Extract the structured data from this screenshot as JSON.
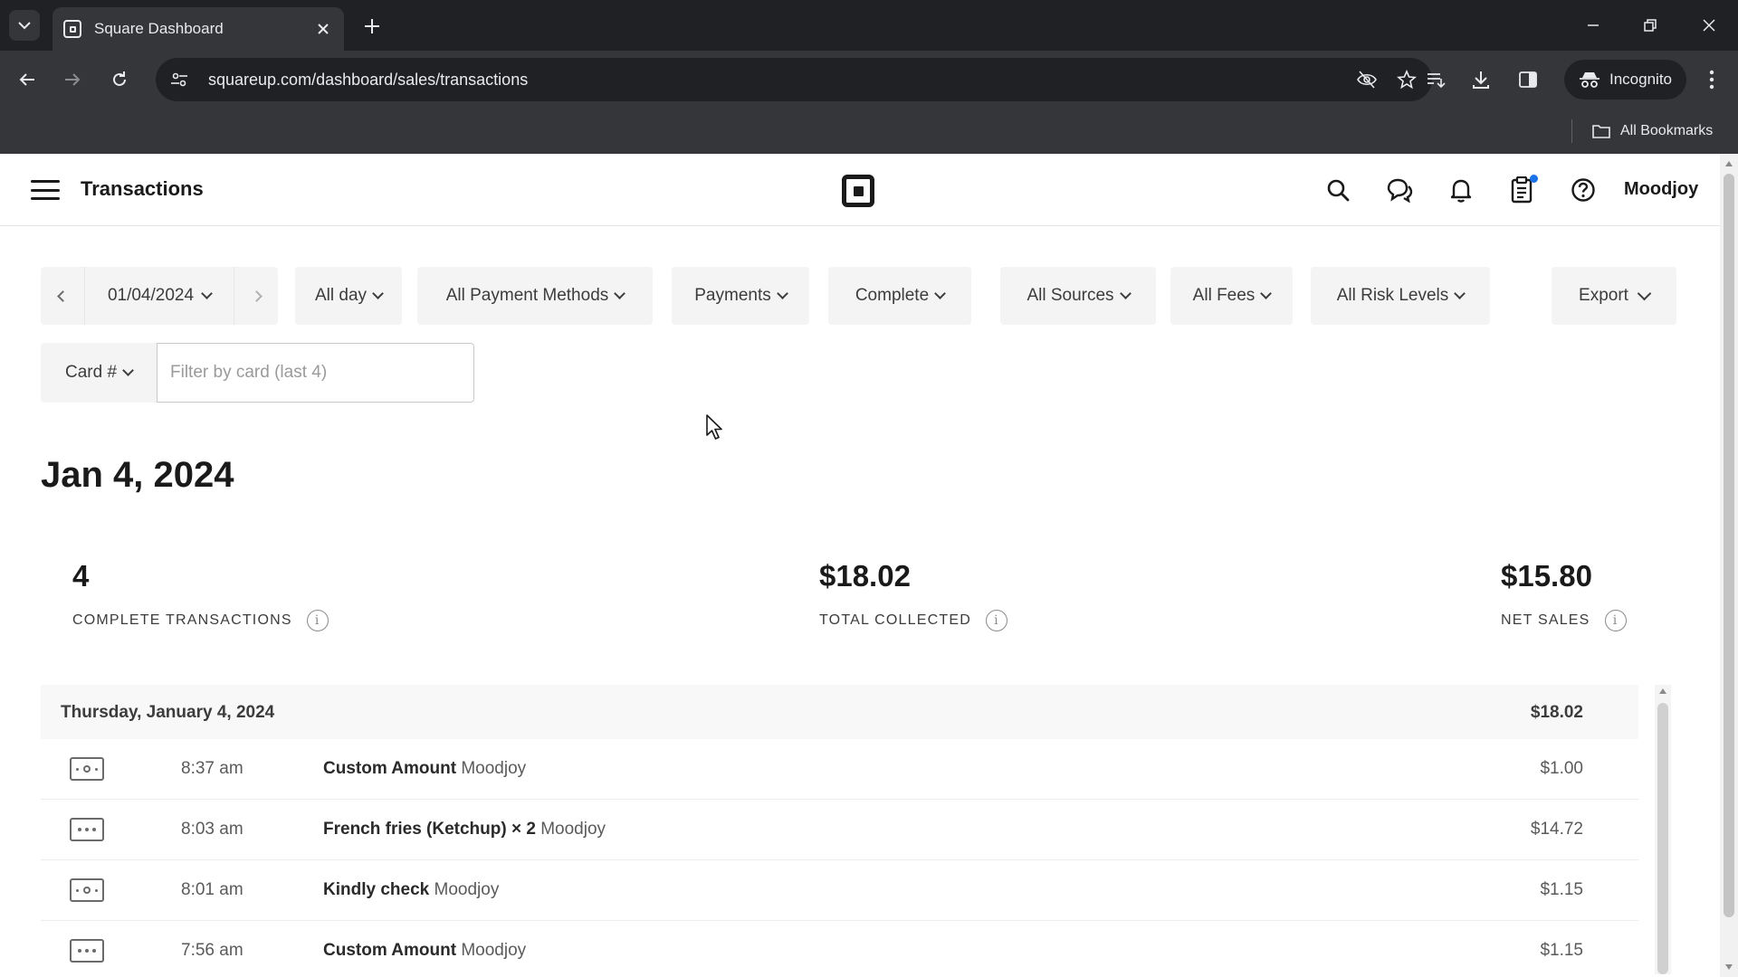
{
  "browser": {
    "tab_title": "Square Dashboard",
    "url": "squareup.com/dashboard/sales/transactions",
    "incognito_label": "Incognito",
    "bookmarks_label": "All Bookmarks"
  },
  "header": {
    "title": "Transactions",
    "user_name": "Moodjoy",
    "has_notification_dot": true,
    "accent_color": "#1a73e8"
  },
  "filters": {
    "date": "01/04/2024",
    "time_range": "All day",
    "payment_methods": "All Payment Methods",
    "type": "Payments",
    "status": "Complete",
    "sources": "All Sources",
    "fees": "All Fees",
    "risk_levels": "All Risk Levels",
    "export_label": "Export",
    "card_select_label": "Card #",
    "card_filter_placeholder": "Filter by card (last 4)",
    "card_filter_value": ""
  },
  "summary": {
    "date_heading": "Jan 4, 2024",
    "stats": [
      {
        "value": "4",
        "label": "COMPLETE TRANSACTIONS"
      },
      {
        "value": "$18.02",
        "label": "TOTAL COLLECTED"
      },
      {
        "value": "$15.80",
        "label": "NET SALES"
      }
    ]
  },
  "transactions": {
    "day_label": "Thursday, January 4, 2024",
    "day_total": "$18.02",
    "rows": [
      {
        "icon": "cash-icon",
        "time": "8:37 am",
        "item": "Custom Amount",
        "location": "Moodjoy",
        "amount": "$1.00"
      },
      {
        "icon": "other-payment-icon",
        "time": "8:03 am",
        "item": "French fries (Ketchup) × 2",
        "location": "Moodjoy",
        "amount": "$14.72"
      },
      {
        "icon": "cash-icon",
        "time": "8:01 am",
        "item": "Kindly check",
        "location": "Moodjoy",
        "amount": "$1.15"
      },
      {
        "icon": "other-payment-icon",
        "time": "7:56 am",
        "item": "Custom Amount",
        "location": "Moodjoy",
        "amount": "$1.15"
      }
    ]
  }
}
